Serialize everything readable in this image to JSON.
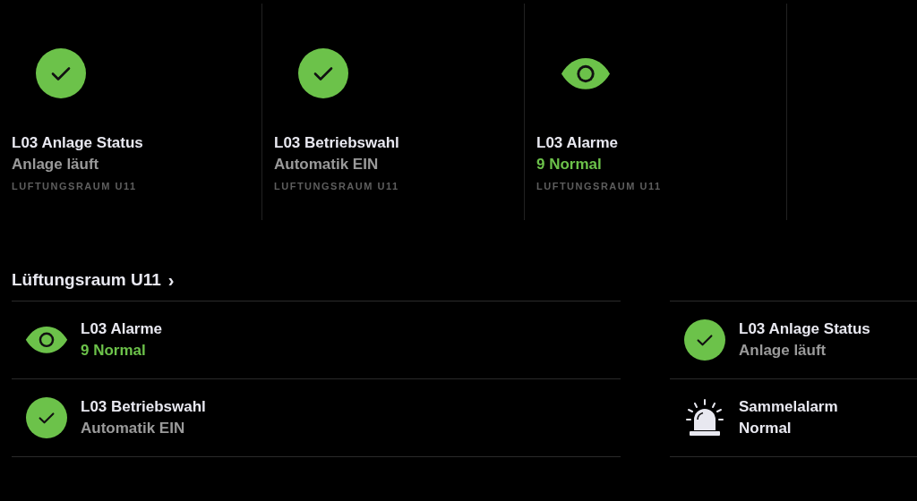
{
  "cards": [
    {
      "kind": "check",
      "title": "L03 Anlage Status",
      "value": "Anlage läuft",
      "color": "#9a9a9a",
      "location": "LUFTUNGSRAUM U11"
    },
    {
      "kind": "check",
      "title": "L03 Betriebswahl",
      "value": "Automatik EIN",
      "color": "#9a9a9a",
      "location": "LUFTUNGSRAUM U11"
    },
    {
      "kind": "eye",
      "title": "L03 Alarme",
      "value": "9 Normal",
      "color": "#6cc24a",
      "location": "LUFTUNGSRAUM U11"
    }
  ],
  "section": {
    "title": "Lüftungsraum U11",
    "chevron": "›"
  },
  "columns": [
    [
      {
        "kind": "eye",
        "title": "L03 Alarme",
        "value": "9 Normal",
        "color": "#6cc24a"
      },
      {
        "kind": "check",
        "title": "L03 Betriebswahl",
        "value": "Automatik EIN",
        "color": "#9a9a9a"
      }
    ],
    [
      {
        "kind": "check",
        "title": "L03 Anlage Status",
        "value": "Anlage läuft",
        "color": "#9a9a9a"
      },
      {
        "kind": "siren",
        "title": "Sammelalarm",
        "value": "Normal",
        "color": "#e8e8f0"
      }
    ]
  ]
}
